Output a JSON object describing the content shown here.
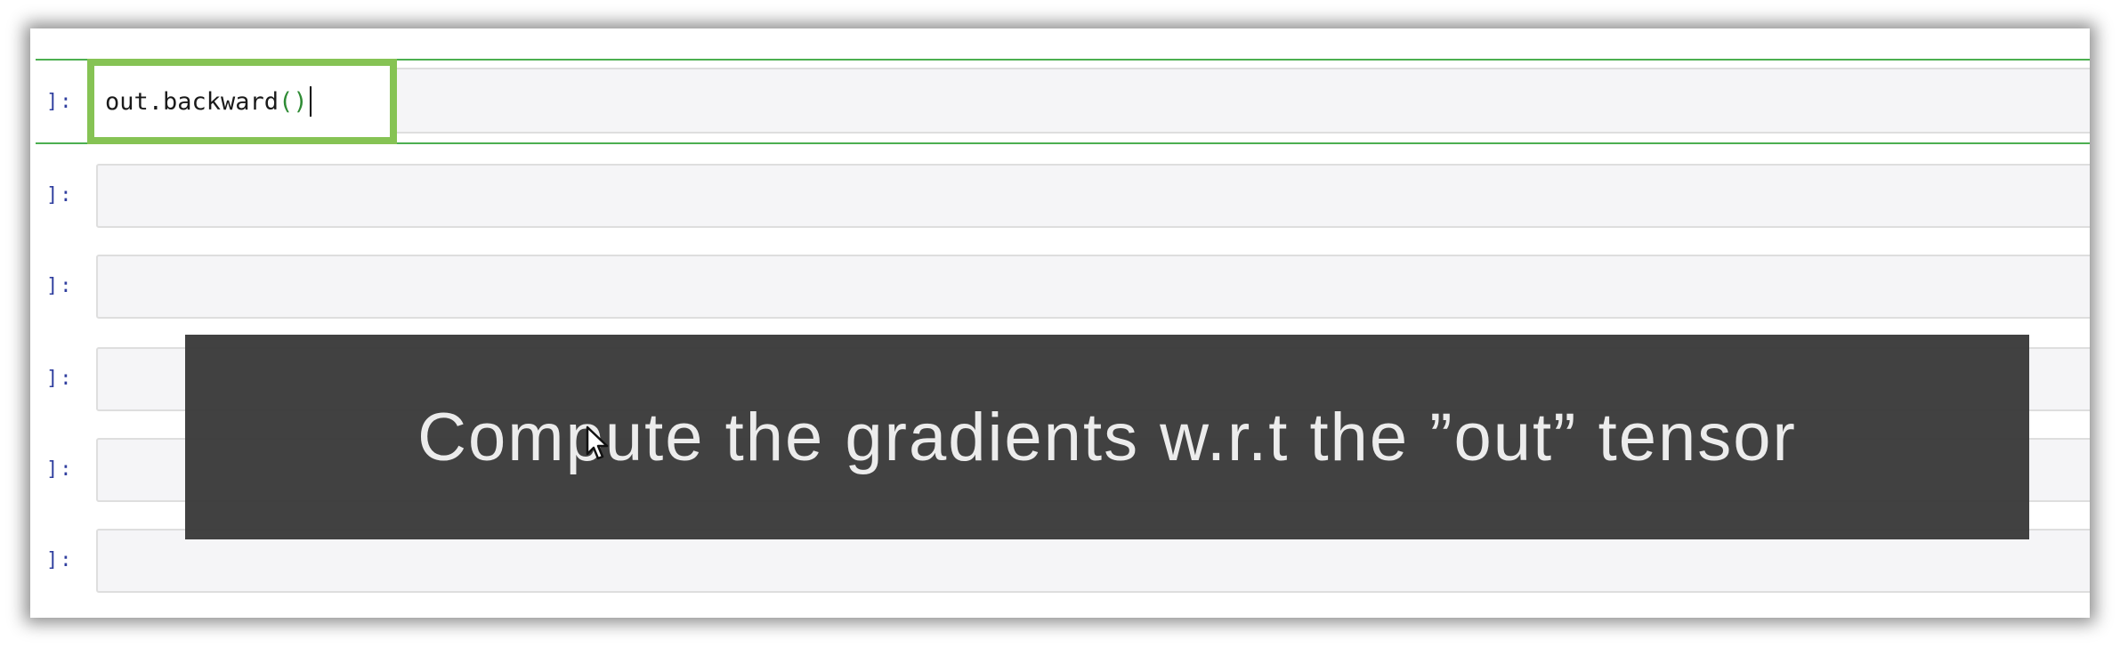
{
  "notebook": {
    "selected_cell": {
      "prompt": "]:",
      "code_name": "out.backward",
      "code_open_paren": "(",
      "code_close_paren": ")"
    },
    "empty_cells": [
      {
        "prompt": "]:"
      },
      {
        "prompt": "]:"
      },
      {
        "prompt": "]:"
      },
      {
        "prompt": "]:"
      },
      {
        "prompt": "]:"
      }
    ]
  },
  "caption": {
    "text": "Compute the gradients w.r.t the ”out” tensor"
  },
  "colors": {
    "selected_border": "#86c354",
    "selection_line": "#4caf50",
    "prompt_color": "#303f9f",
    "paren_color": "#2e8b34",
    "caption_bg": "#373737"
  },
  "icons": {
    "pointer": "mouse-pointer-icon"
  }
}
